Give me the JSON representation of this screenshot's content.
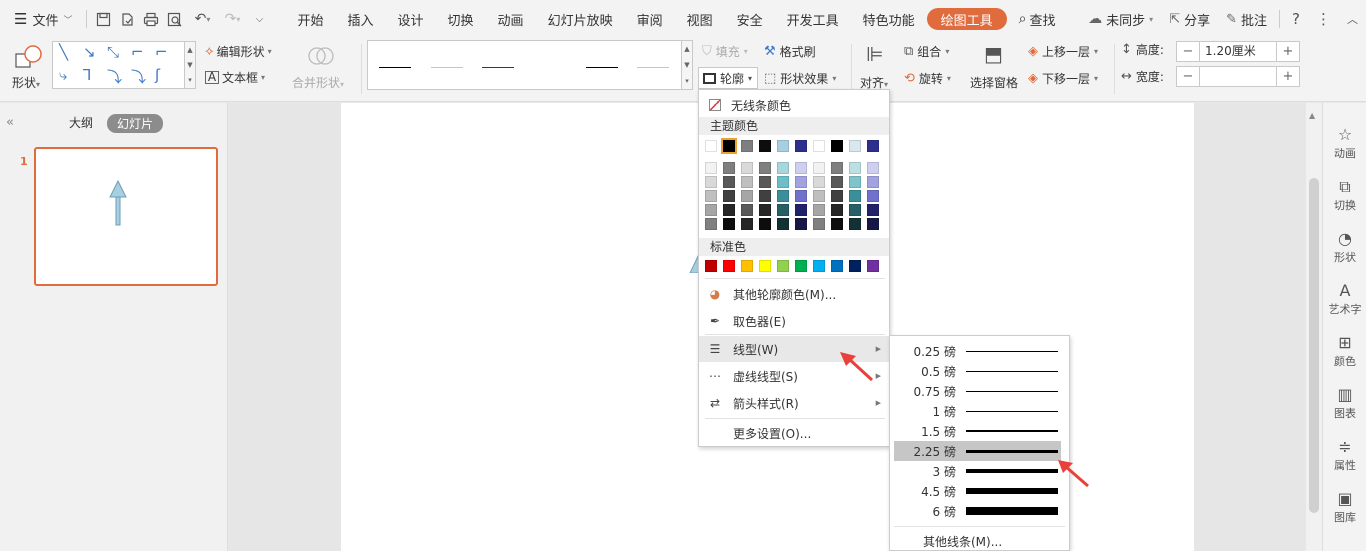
{
  "menubar": {
    "file_label": "文件",
    "tabs": [
      "开始",
      "插入",
      "设计",
      "切换",
      "动画",
      "幻灯片放映",
      "审阅",
      "视图",
      "安全",
      "开发工具",
      "特色功能",
      "绘图工具"
    ],
    "search_label": "查找",
    "sync_label": "未同步",
    "share_label": "分享",
    "comment_label": "批注"
  },
  "ribbon": {
    "shape_label": "形状",
    "edit_shape_label": "编辑形状",
    "textbox_label": "文本框",
    "merge_shape_label": "合并形状",
    "fill_label": "填充",
    "format_painter_label": "格式刷",
    "outline_label": "轮廓",
    "shape_effect_label": "形状效果",
    "align_label": "对齐",
    "group_label": "组合",
    "rotate_label": "旋转",
    "selection_pane_label": "选择窗格",
    "bring_forward_label": "上移一层",
    "send_backward_label": "下移一层",
    "height_label": "高度:",
    "height_value": "1.20厘米",
    "width_label": "宽度:",
    "width_value": "",
    "line_styles": [
      "#000000",
      "#a8cfe0",
      "#2c2f8e",
      "#ffffff",
      "#000000",
      "#a8cfe0"
    ]
  },
  "left_panel": {
    "tab_outline": "大纲",
    "tab_slides": "幻灯片",
    "slide_number": "1"
  },
  "right_rail": [
    "动画",
    "切换",
    "形状",
    "艺术字",
    "颜色",
    "图表",
    "属性",
    "图库"
  ],
  "color_menu": {
    "no_line_label": "无线条颜色",
    "theme_header": "主题颜色",
    "theme_top": [
      "#ffffff",
      "#000000",
      "#7f7f7f",
      "#0d0d0d",
      "#a8cfe0",
      "#2c2f8e",
      "#ffffff",
      "#000000",
      "#d8e8ee",
      "#2c2f8e"
    ],
    "theme_shades": [
      [
        "#f2f2f2",
        "#d9d9d9",
        "#bfbfbf",
        "#a6a6a6",
        "#808080"
      ],
      [
        "#7f7f7f",
        "#595959",
        "#404040",
        "#262626",
        "#0d0d0d"
      ],
      [
        "#d9d9d9",
        "#bfbfbf",
        "#a6a6a6",
        "#595959",
        "#262626"
      ],
      [
        "#7f7f7f",
        "#595959",
        "#404040",
        "#262626",
        "#0d0d0d"
      ],
      [
        "#a7d6db",
        "#6cbfc8",
        "#3b8f9a",
        "#275f67",
        "#133034"
      ],
      [
        "#cfd0ef",
        "#a1a2df",
        "#6f71cc",
        "#21236a",
        "#161747"
      ],
      [
        "#f2f2f2",
        "#d9d9d9",
        "#bfbfbf",
        "#a6a6a6",
        "#808080"
      ],
      [
        "#7f7f7f",
        "#595959",
        "#404040",
        "#262626",
        "#0d0d0d"
      ],
      [
        "#bcdfe2",
        "#7fc4cb",
        "#3b8f9a",
        "#275f67",
        "#133034"
      ],
      [
        "#cfd0ef",
        "#a1a2df",
        "#6f71cc",
        "#21236a",
        "#161747"
      ]
    ],
    "standard_header": "标准色",
    "standard_colors": [
      "#c00000",
      "#ff0000",
      "#ffc000",
      "#ffff00",
      "#92d050",
      "#00b050",
      "#00b0f0",
      "#0070c0",
      "#002060",
      "#7030a0"
    ],
    "more_colors_label": "其他轮廓颜色(M)...",
    "eyedropper_label": "取色器(E)",
    "line_type_label": "线型(W)",
    "dash_type_label": "虚线线型(S)",
    "arrow_style_label": "箭头样式(R)",
    "more_settings_label": "更多设置(O)..."
  },
  "line_weight_menu": {
    "items": [
      {
        "label": "0.25 磅",
        "weight": 0.25
      },
      {
        "label": "0.5 磅",
        "weight": 0.5
      },
      {
        "label": "0.75 磅",
        "weight": 0.75
      },
      {
        "label": "1 磅",
        "weight": 1
      },
      {
        "label": "1.5 磅",
        "weight": 1.5
      },
      {
        "label": "2.25 磅",
        "weight": 2.25
      },
      {
        "label": "3 磅",
        "weight": 3
      },
      {
        "label": "4.5 磅",
        "weight": 4.5
      },
      {
        "label": "6 磅",
        "weight": 6
      }
    ],
    "selected": "2.25 磅",
    "more_lines_label": "其他线条(M)..."
  },
  "colors": {
    "accent": "#e06b3d",
    "shape_fill": "#a8cfe0",
    "annotation_arrow": "#e8403a"
  }
}
